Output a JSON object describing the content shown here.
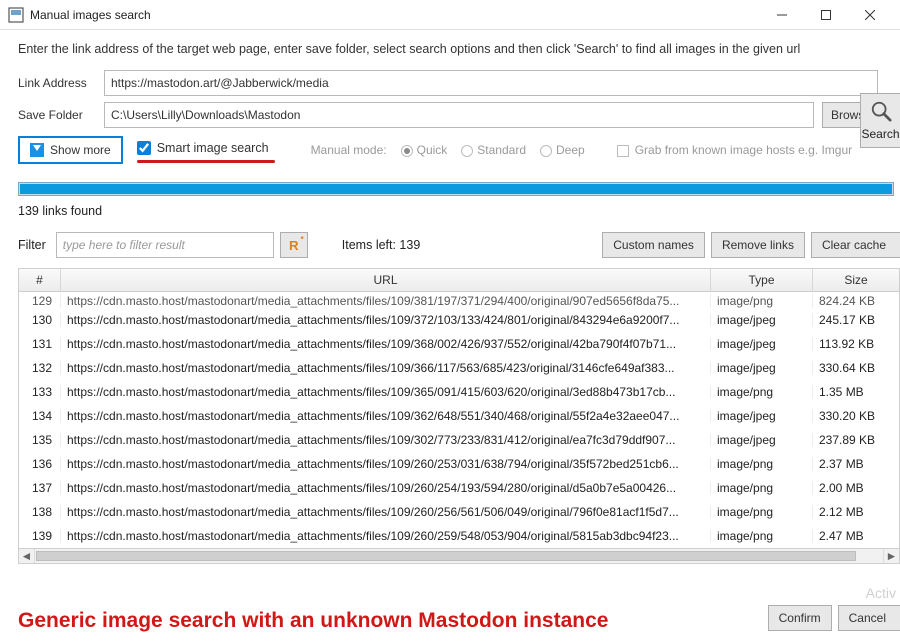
{
  "window": {
    "title": "Manual images search"
  },
  "instructions": "Enter the link address of the target web page, enter save folder, select search options and then click 'Search' to find all images in the given url",
  "labels": {
    "link_address": "Link Address",
    "save_folder": "Save Folder",
    "browse": "Browse",
    "search": "Search",
    "show_more": "Show more",
    "smart_image_search": "Smart image search",
    "manual_mode": "Manual mode:",
    "quick": "Quick",
    "standard": "Standard",
    "deep": "Deep",
    "grab_hosts": "Grab from known image hosts e.g. Imgur",
    "links_found": "139 links found",
    "filter": "Filter",
    "filter_placeholder": "type here to filter result",
    "items_left": "Items left: 139",
    "custom_names": "Custom names",
    "remove_links": "Remove links",
    "clear_cache": "Clear cache",
    "confirm": "Confirm",
    "cancel": "Cancel"
  },
  "inputs": {
    "link_address": "https://mastodon.art/@Jabberwick/media",
    "save_folder": "C:\\Users\\Lilly\\Downloads\\Mastodon"
  },
  "table": {
    "headers": {
      "num": "#",
      "url": "URL",
      "type": "Type",
      "size": "Size"
    },
    "rows": [
      {
        "num": "129",
        "url": "https://cdn.masto.host/mastodonart/media_attachments/files/109/381/197/371/294/400/original/907ed5656f8da75...",
        "type": "image/png",
        "size": "824.24 KB",
        "half": true
      },
      {
        "num": "130",
        "url": "https://cdn.masto.host/mastodonart/media_attachments/files/109/372/103/133/424/801/original/843294e6a9200f7...",
        "type": "image/jpeg",
        "size": "245.17 KB"
      },
      {
        "num": "131",
        "url": "https://cdn.masto.host/mastodonart/media_attachments/files/109/368/002/426/937/552/original/42ba790f4f07b71...",
        "type": "image/jpeg",
        "size": "113.92 KB"
      },
      {
        "num": "132",
        "url": "https://cdn.masto.host/mastodonart/media_attachments/files/109/366/117/563/685/423/original/3146cfe649af383...",
        "type": "image/jpeg",
        "size": "330.64 KB"
      },
      {
        "num": "133",
        "url": "https://cdn.masto.host/mastodonart/media_attachments/files/109/365/091/415/603/620/original/3ed88b473b17cb...",
        "type": "image/png",
        "size": "1.35 MB"
      },
      {
        "num": "134",
        "url": "https://cdn.masto.host/mastodonart/media_attachments/files/109/362/648/551/340/468/original/55f2a4e32aee047...",
        "type": "image/jpeg",
        "size": "330.20 KB"
      },
      {
        "num": "135",
        "url": "https://cdn.masto.host/mastodonart/media_attachments/files/109/302/773/233/831/412/original/ea7fc3d79ddf907...",
        "type": "image/jpeg",
        "size": "237.89 KB"
      },
      {
        "num": "136",
        "url": "https://cdn.masto.host/mastodonart/media_attachments/files/109/260/253/031/638/794/original/35f572bed251cb6...",
        "type": "image/png",
        "size": "2.37 MB"
      },
      {
        "num": "137",
        "url": "https://cdn.masto.host/mastodonart/media_attachments/files/109/260/254/193/594/280/original/d5a0b7e5a00426...",
        "type": "image/png",
        "size": "2.00 MB"
      },
      {
        "num": "138",
        "url": "https://cdn.masto.host/mastodonart/media_attachments/files/109/260/256/561/506/049/original/796f0e81acf1f5d7...",
        "type": "image/png",
        "size": "2.12 MB"
      },
      {
        "num": "139",
        "url": "https://cdn.masto.host/mastodonart/media_attachments/files/109/260/259/548/053/904/original/5815ab3dbc94f23...",
        "type": "image/png",
        "size": "2.47 MB"
      }
    ]
  },
  "caption": "Generic image search with an unknown Mastodon instance",
  "watermark": "Activ"
}
